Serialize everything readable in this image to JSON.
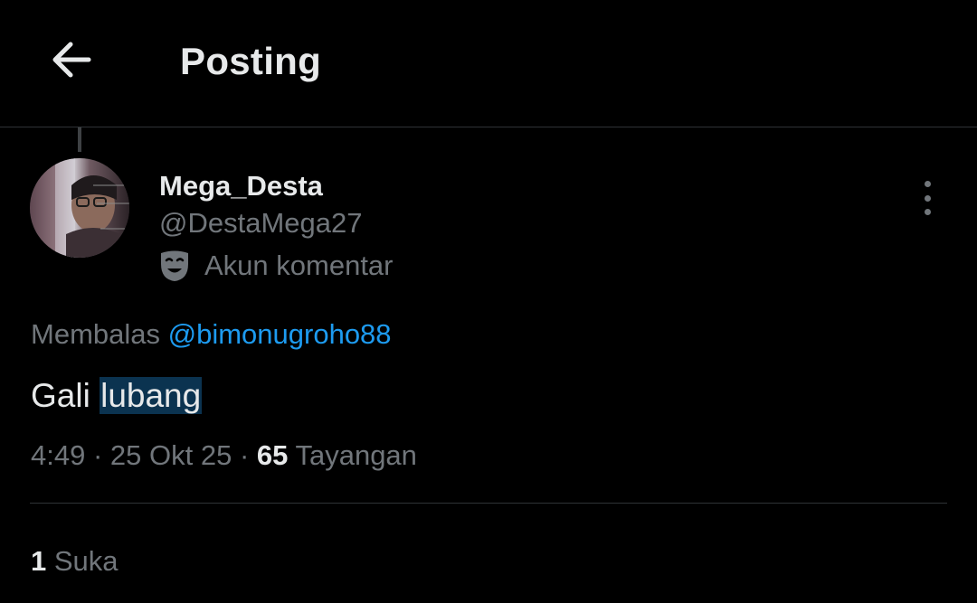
{
  "header": {
    "title": "Posting",
    "back_icon": "arrow-left-icon"
  },
  "post": {
    "author": {
      "display_name": "Mega_Desta",
      "handle": "@DestaMega27",
      "account_label": "Akun komentar",
      "account_label_icon": "theater-mask-icon"
    },
    "more_icon": "more-vertical-icon",
    "reply_prefix": "Membalas",
    "reply_to": "@bimonugroho88",
    "text_plain": "Gali",
    "text_highlighted": "lubang",
    "time": "4:49",
    "date": "25 Okt 25",
    "separator": "·",
    "views_count": "65",
    "views_label": "Tayangan",
    "likes_count": "1",
    "likes_label": "Suka"
  },
  "colors": {
    "background": "#000000",
    "primary_text": "#e7e9ea",
    "secondary_text": "#71767b",
    "link": "#1d9bf0",
    "divider": "#2f3336",
    "selection_highlight": "#0b3350"
  }
}
